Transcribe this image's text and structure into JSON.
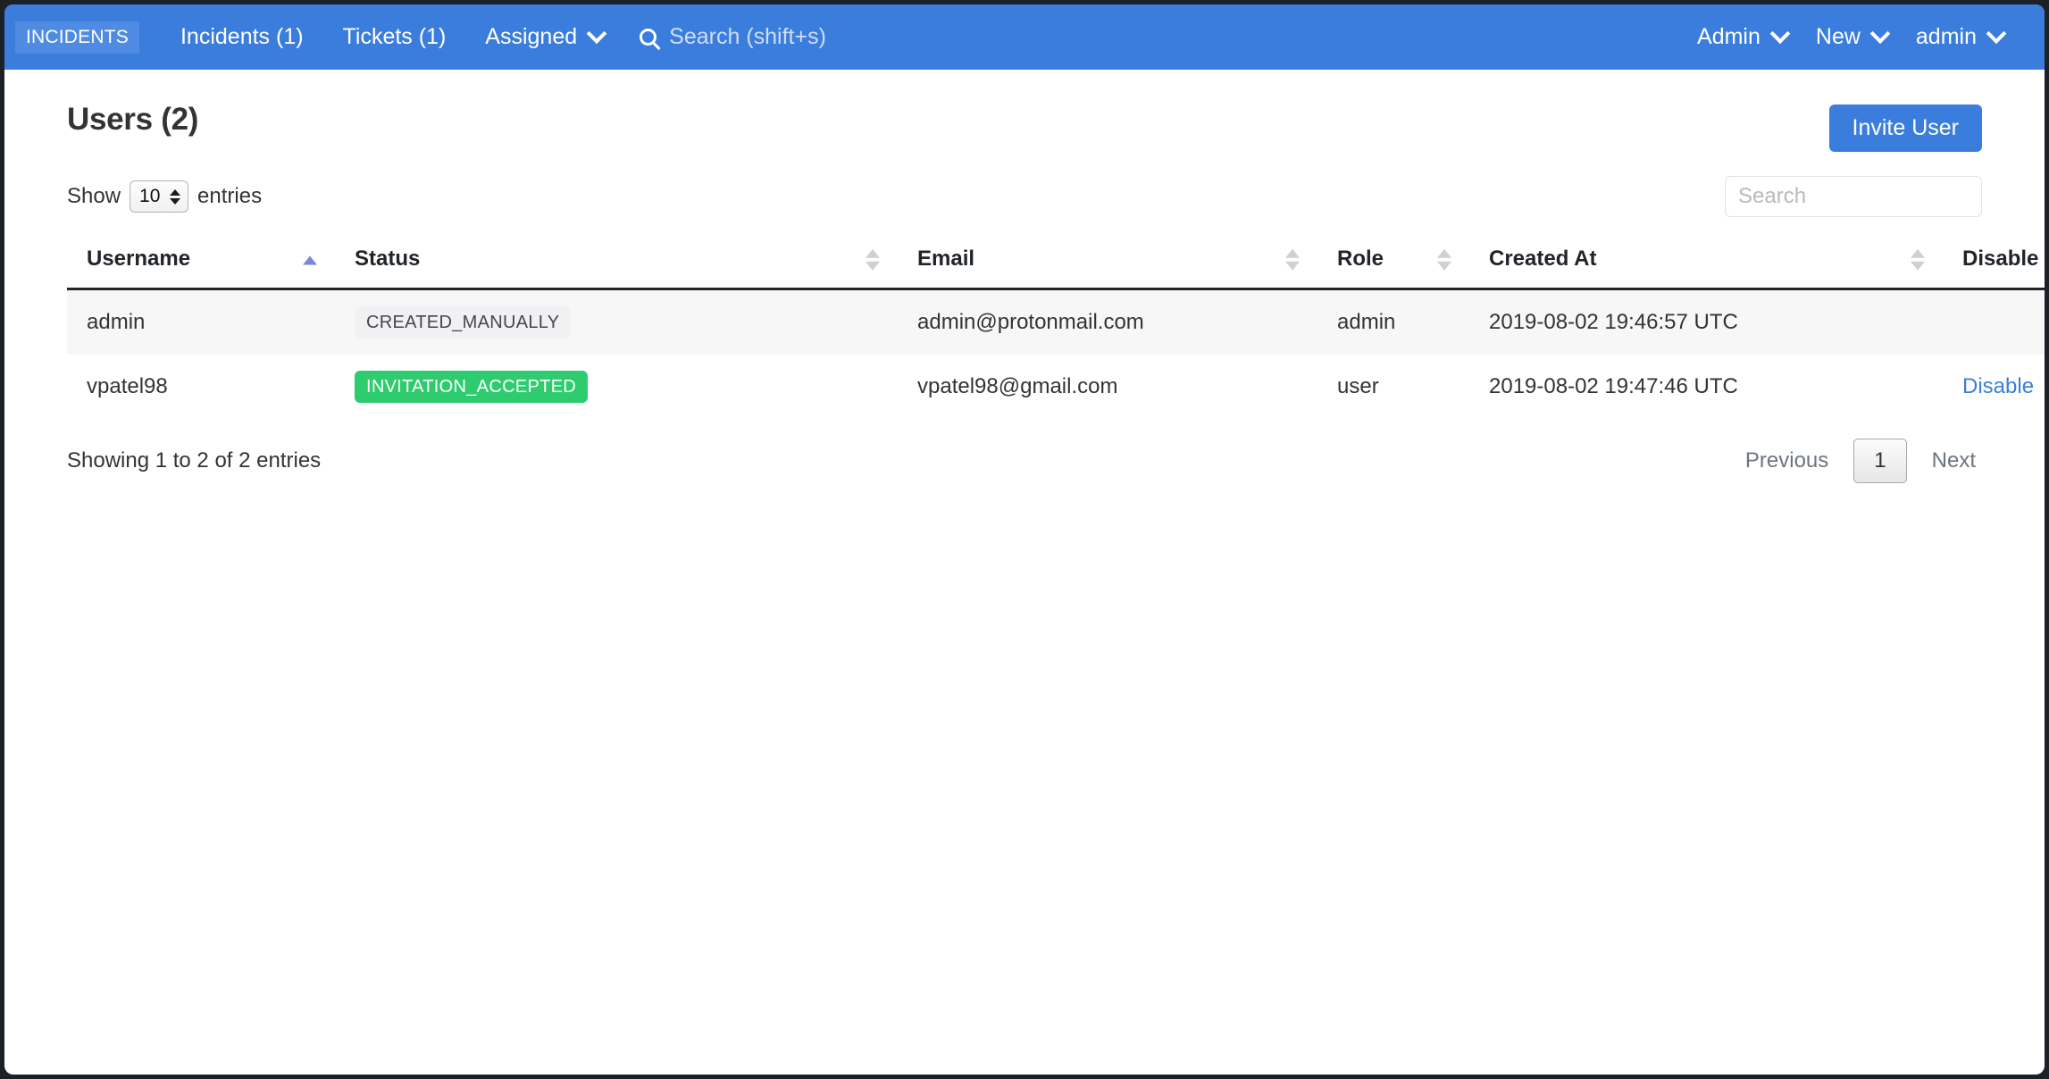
{
  "navbar": {
    "brand": "INCIDENTS",
    "links": [
      {
        "label": "Incidents (1)",
        "dropdown": false
      },
      {
        "label": "Tickets (1)",
        "dropdown": false
      },
      {
        "label": "Assigned",
        "dropdown": true
      }
    ],
    "search_placeholder": "Search (shift+s)",
    "search_icon": "search-icon",
    "right_links": [
      {
        "label": "Admin",
        "dropdown": true
      },
      {
        "label": "New",
        "dropdown": true
      },
      {
        "label": "admin",
        "dropdown": true
      }
    ],
    "background_color": "#3b7ddd"
  },
  "page": {
    "title": "Users (2)",
    "invite_button": "Invite User"
  },
  "table_controls": {
    "show_label": "Show",
    "page_length": "10",
    "entries_label": "entries",
    "search_placeholder": "Search",
    "search_value": ""
  },
  "table": {
    "columns": [
      {
        "label": "Username",
        "sort": "asc"
      },
      {
        "label": "Status",
        "sort": "none"
      },
      {
        "label": "Email",
        "sort": "none"
      },
      {
        "label": "Role",
        "sort": "none"
      },
      {
        "label": "Created At",
        "sort": "none"
      },
      {
        "label": "Disable",
        "sort": "none"
      }
    ],
    "rows": [
      {
        "username": "admin",
        "status": "CREATED_MANUALLY",
        "status_style": "gray",
        "email": "admin@protonmail.com",
        "role": "admin",
        "created_at": "2019-08-02 19:46:57 UTC",
        "disable": ""
      },
      {
        "username": "vpatel98",
        "status": "INVITATION_ACCEPTED",
        "status_style": "green",
        "email": "vpatel98@gmail.com",
        "role": "user",
        "created_at": "2019-08-02 19:47:46 UTC",
        "disable": "Disable"
      }
    ]
  },
  "footer": {
    "info": "Showing 1 to 2 of 2 entries",
    "previous": "Previous",
    "current_page": "1",
    "next": "Next"
  },
  "colors": {
    "accent": "#3b7ddd",
    "badge_green": "#2fcc6f",
    "badge_gray": "#f1f1f3",
    "link": "#3b7ddd"
  }
}
